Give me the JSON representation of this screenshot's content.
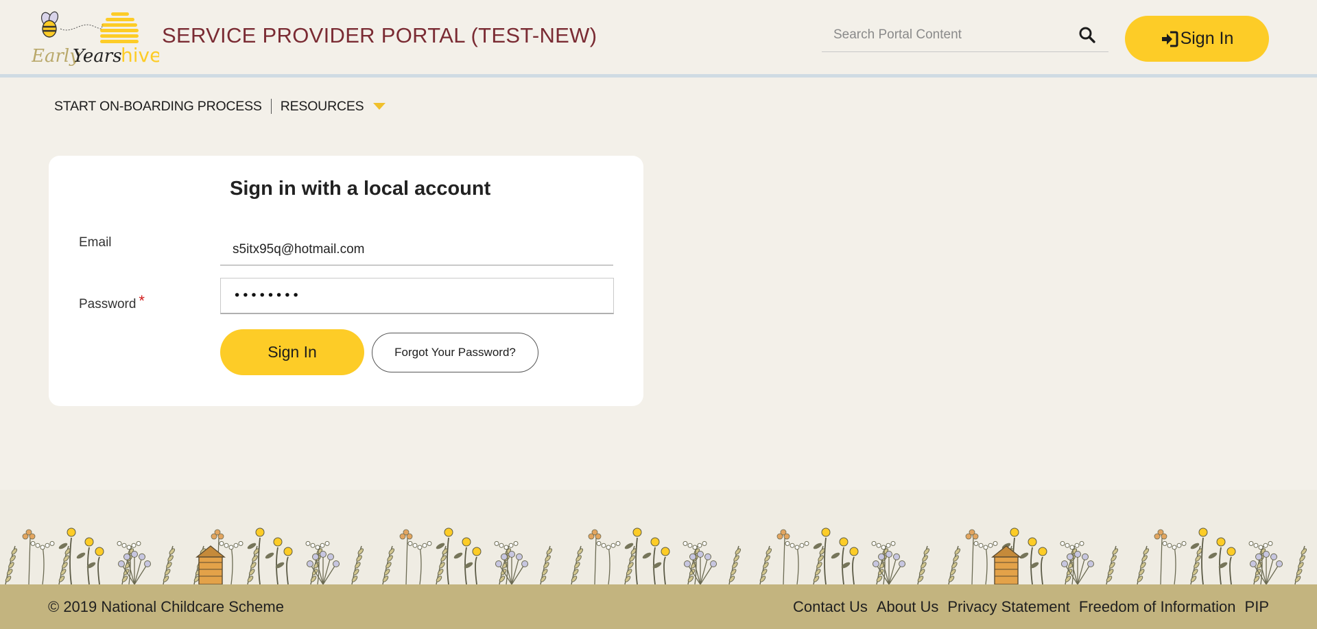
{
  "header": {
    "logo_text_early": "Early",
    "logo_text_years": "Years",
    "logo_text_hive": "hive",
    "title": "SERVICE PROVIDER PORTAL (TEST-NEW)",
    "search_placeholder": "Search Portal Content",
    "signin_label": "Sign In"
  },
  "nav": {
    "items": [
      {
        "label": "START ON-BOARDING PROCESS"
      },
      {
        "label": "RESOURCES"
      }
    ]
  },
  "signin_form": {
    "title": "Sign in with a local account",
    "email_label": "Email",
    "email_value": "s5itx95q@hotmail.com",
    "password_label": "Password",
    "required_mark": "*",
    "password_value": "••••••••",
    "submit_label": "Sign In",
    "forgot_label": "Forgot Your Password?"
  },
  "footer": {
    "copyright": "© 2019 National Childcare Scheme",
    "links": [
      {
        "label": "Contact Us"
      },
      {
        "label": "About Us"
      },
      {
        "label": "Privacy Statement"
      },
      {
        "label": "Freedom of Information"
      },
      {
        "label": "PIP"
      }
    ]
  },
  "colors": {
    "accent_yellow": "#fdcc27",
    "title_maroon": "#7a2b33",
    "footer_bar": "#c3b47f",
    "page_bg": "#f3f0e9"
  },
  "icons": {
    "search": "search-icon",
    "signin": "sign-in-arrow-icon",
    "caret": "caret-down-icon",
    "logo": "bee-logo-icon"
  }
}
